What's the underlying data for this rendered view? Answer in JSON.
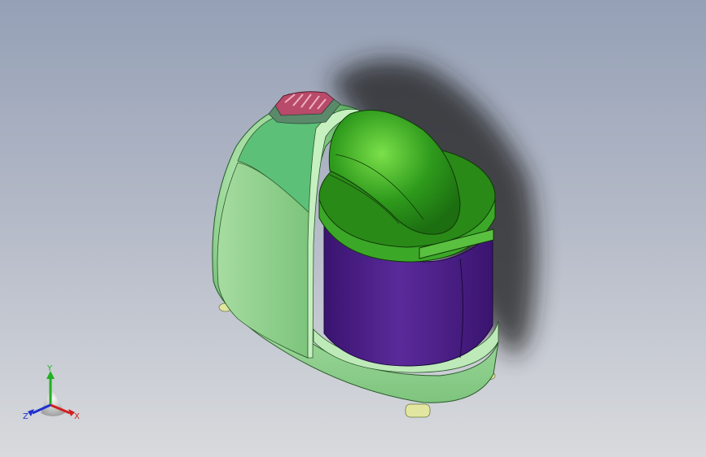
{
  "viewport": {
    "background_top": "#95a0b6",
    "background_bottom": "#d8dadd"
  },
  "model": {
    "description_icon": "food-processor-3d-model",
    "colors": {
      "body": "#8fd08f",
      "lid": "#2e9a1c",
      "bowl": "#4a1f8a",
      "button": "#b84a6a",
      "feet": "#e2e6a0"
    }
  },
  "triad": {
    "x_label": "X",
    "y_label": "Y",
    "z_label": "Z",
    "x_color": "#d02020",
    "y_color": "#20b020",
    "z_color": "#2030d0"
  }
}
